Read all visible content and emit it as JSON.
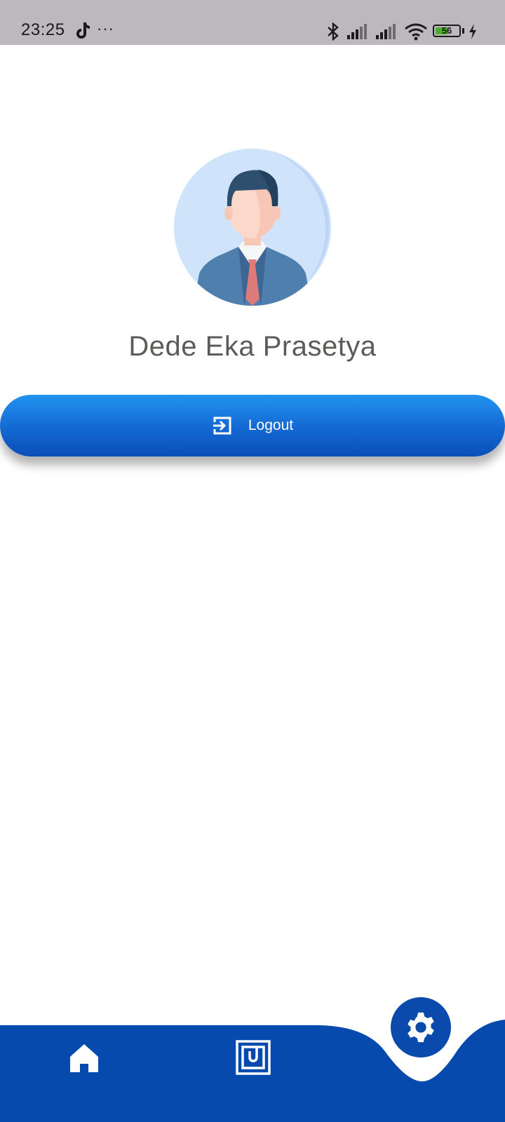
{
  "status_bar": {
    "time": "23:25",
    "more": "···",
    "battery_level": "56",
    "battery_fraction": 0.56,
    "icons": [
      "tiktok-icon",
      "bluetooth-icon",
      "signal-icon",
      "signal-icon",
      "wifi-icon",
      "battery-icon",
      "charging-icon"
    ]
  },
  "profile": {
    "name": "Dede Eka Prasetya",
    "avatar_icon": "businessman-avatar"
  },
  "logout": {
    "label": "Logout",
    "icon": "logout-icon"
  },
  "bottom_nav": {
    "items": [
      {
        "icon": "home-icon",
        "active": false
      },
      {
        "icon": "nfc-card-icon",
        "active": false
      },
      {
        "icon": "gear-icon",
        "active": true
      }
    ],
    "color": "#064aad"
  }
}
